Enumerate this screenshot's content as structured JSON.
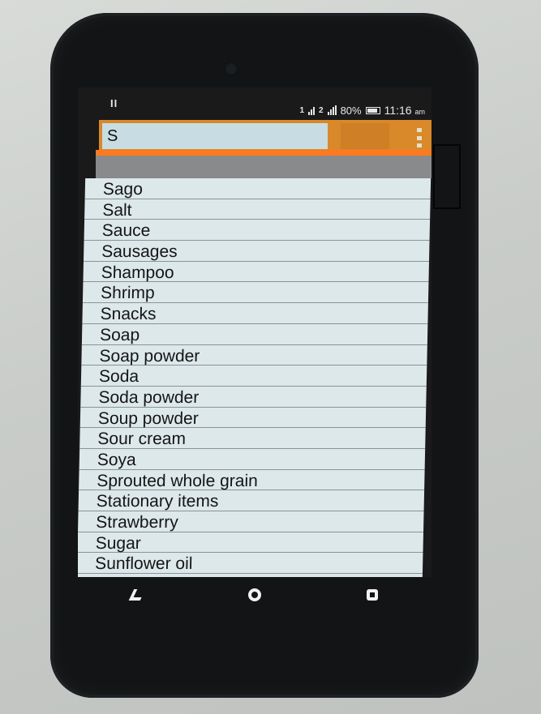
{
  "status_bar": {
    "left_indicator": "II",
    "sim1_label": "1",
    "sim2_label": "2",
    "battery": "80%",
    "time": "11:16",
    "ampm": "am"
  },
  "search": {
    "value": "S"
  },
  "items": [
    "Sago",
    "Salt",
    "Sauce",
    "Sausages",
    "Shampoo",
    "Shrimp",
    "Snacks",
    "Soap",
    "Soap powder",
    "Soda",
    "Soda powder",
    "Soup powder",
    "Sour cream",
    "Soya",
    "Sprouted whole grain",
    "Stationary items",
    "Strawberry",
    "Sugar",
    "Sunflower oil"
  ],
  "icons": {
    "menu": "overflow-menu-icon",
    "back": "back-icon",
    "home": "home-icon",
    "recent": "recent-apps-icon"
  },
  "colors": {
    "toolbar": "#d9882a",
    "accent_bar": "#ff7a1e",
    "list_bg": "#dde8eb"
  }
}
